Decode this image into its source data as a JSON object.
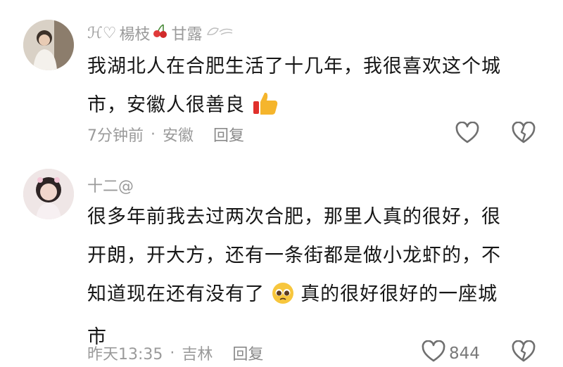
{
  "comments": [
    {
      "user": {
        "name_prefix": "ℋ♡",
        "name_part1": "楊枝",
        "name_part2": "甘露"
      },
      "text_line1": "我湖北人在合肥生活了十几年，我很喜欢这个城",
      "text_line2": "市，安徽人很善良",
      "time": "7分钟前",
      "separator": "·",
      "location": "安徽",
      "reply_label": "回复",
      "like_count": "",
      "icons": [
        "cherries-icon",
        "leaf-icon",
        "thumbs-up-emoji",
        "heart-outline-icon",
        "broken-heart-icon"
      ]
    },
    {
      "user": {
        "name": "十二@"
      },
      "text_line1": "很多年前我去过两次合肥，那里人真的很好，很",
      "text_line2": "开朗，开大方，还有一条街都是做小龙虾的，不",
      "text_line3a": "知道现在还有没有了",
      "text_line3b": "真的很好很好的一座城",
      "text_line4": "市",
      "time": "昨天13:35",
      "separator": "·",
      "location": "吉林",
      "reply_label": "回复",
      "like_count": "844",
      "icons": [
        "pleading-face-emoji",
        "heart-outline-icon",
        "broken-heart-icon"
      ]
    }
  ],
  "colors": {
    "text": "#161616",
    "muted": "#9a9a9a",
    "background": "#ffffff"
  }
}
